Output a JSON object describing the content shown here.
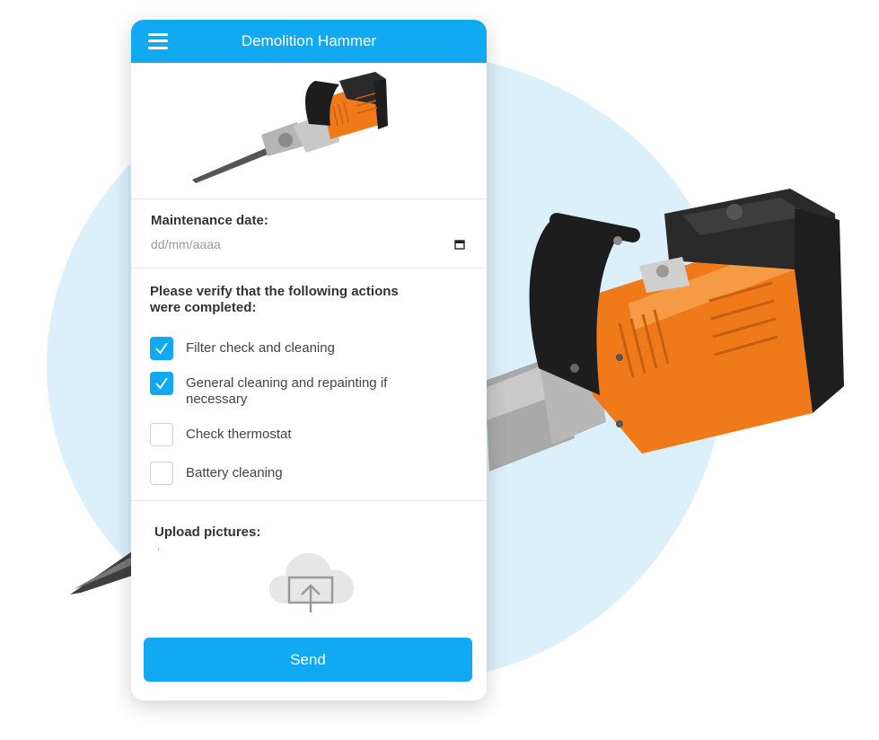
{
  "app": {
    "title": "Demolition Hammer"
  },
  "maintenance": {
    "date_label": "Maintenance date:",
    "date_placeholder": "dd/mm/aaaa"
  },
  "verification": {
    "label": "Please verify that the following actions were completed:",
    "items": [
      {
        "label": "Filter check and cleaning",
        "checked": true
      },
      {
        "label": "General cleaning and repainting if necessary",
        "checked": true
      },
      {
        "label": "Check thermostat",
        "checked": false
      },
      {
        "label": "Battery cleaning",
        "checked": false
      }
    ]
  },
  "upload": {
    "label": "Upload pictures:"
  },
  "actions": {
    "send_label": "Send"
  },
  "colors": {
    "accent": "#12a9f3",
    "blob": "#dbf0fb",
    "hammer_orange": "#f07a1a"
  },
  "icons": {
    "menu": "hamburger-menu-icon",
    "calendar": "calendar-icon",
    "upload": "cloud-upload-icon",
    "check": "checkmark-icon"
  }
}
